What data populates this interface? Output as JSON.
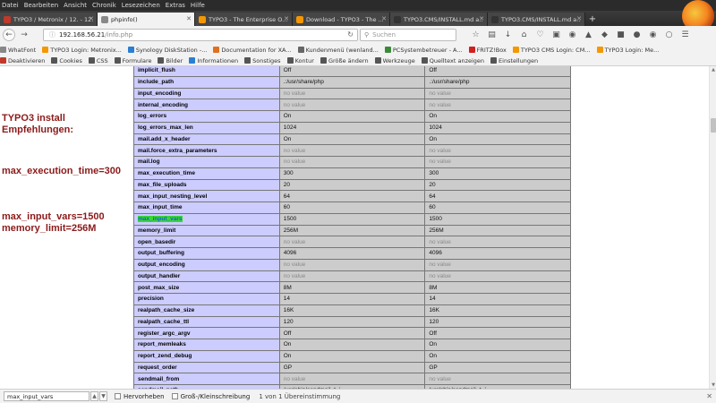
{
  "menu": [
    "Datei",
    "Bearbeiten",
    "Ansicht",
    "Chronik",
    "Lesezeichen",
    "Extras",
    "Hilfe"
  ],
  "tabs": [
    {
      "title": "TYPO3 / Metronix / 12. - 12.",
      "icon_color": "#c0392b",
      "active": false
    },
    {
      "title": "phpinfo()",
      "icon_color": "#888888",
      "active": true
    },
    {
      "title": "TYPO3 - The Enterprise O...",
      "icon_color": "#f49700",
      "active": false
    },
    {
      "title": "Download - TYPO3 - The ...",
      "icon_color": "#f49700",
      "active": false
    },
    {
      "title": "TYPO3.CMS/INSTALL.md a...",
      "icon_color": "#333333",
      "active": false
    },
    {
      "title": "TYPO3.CMS/INSTALL.md a...",
      "icon_color": "#333333",
      "active": false
    }
  ],
  "newtab_label": "+",
  "url": {
    "host": "192.168.56.21",
    "path": "/info.php"
  },
  "search_placeholder": "Suchen",
  "bookmarks_row1": [
    {
      "label": "WhatFont",
      "color": "#888"
    },
    {
      "label": "TYPO3 Login: Metronix...",
      "color": "#f49700"
    },
    {
      "label": "Synology DiskStation -...",
      "color": "#2a7fd4"
    },
    {
      "label": "Documentation for XA...",
      "color": "#e07020"
    },
    {
      "label": "Kundenmenü (wenland...",
      "color": "#666"
    },
    {
      "label": "PCSystembetreuer - A...",
      "color": "#3a8a3a"
    },
    {
      "label": "FRITZ!Box",
      "color": "#d02020"
    },
    {
      "label": "TYPO3 CMS Login: CM...",
      "color": "#f49700"
    },
    {
      "label": "TYPO3 Login: Me...",
      "color": "#f49700"
    }
  ],
  "bookmarks_row2": [
    {
      "label": "Deaktivieren",
      "color": "#c0392b"
    },
    {
      "label": "Cookies",
      "color": "#555"
    },
    {
      "label": "CSS",
      "color": "#555"
    },
    {
      "label": "Formulare",
      "color": "#555"
    },
    {
      "label": "Bilder",
      "color": "#555"
    },
    {
      "label": "Informationen",
      "color": "#2a7fd4"
    },
    {
      "label": "Sonstiges",
      "color": "#555"
    },
    {
      "label": "Kontur",
      "color": "#555"
    },
    {
      "label": "Größe ändern",
      "color": "#555"
    },
    {
      "label": "Werkzeuge",
      "color": "#555"
    },
    {
      "label": "Quelltext anzeigen",
      "color": "#555"
    },
    {
      "label": "Einstellungen",
      "color": "#555"
    }
  ],
  "notes": {
    "heading": "TYPO3 install\nEmpfehlungen:",
    "exec_time": "max_execution_time=300",
    "input_vars_memory": "max_input_vars=1500\nmemory_limit=256M"
  },
  "rows": [
    {
      "key": "implicit_flush",
      "local": "Off",
      "master": "Off",
      "nv": false
    },
    {
      "key": "include_path",
      "local": ".:/usr/share/php",
      "master": ".:/usr/share/php",
      "nv": false
    },
    {
      "key": "input_encoding",
      "local": "no value",
      "master": "no value",
      "nv": true
    },
    {
      "key": "internal_encoding",
      "local": "no value",
      "master": "no value",
      "nv": true
    },
    {
      "key": "log_errors",
      "local": "On",
      "master": "On",
      "nv": false
    },
    {
      "key": "log_errors_max_len",
      "local": "1024",
      "master": "1024",
      "nv": false
    },
    {
      "key": "mail.add_x_header",
      "local": "On",
      "master": "On",
      "nv": false
    },
    {
      "key": "mail.force_extra_parameters",
      "local": "no value",
      "master": "no value",
      "nv": true
    },
    {
      "key": "mail.log",
      "local": "no value",
      "master": "no value",
      "nv": true
    },
    {
      "key": "max_execution_time",
      "local": "300",
      "master": "300",
      "nv": false
    },
    {
      "key": "max_file_uploads",
      "local": "20",
      "master": "20",
      "nv": false
    },
    {
      "key": "max_input_nesting_level",
      "local": "64",
      "master": "64",
      "nv": false
    },
    {
      "key": "max_input_time",
      "local": "60",
      "master": "60",
      "nv": false
    },
    {
      "key": "max_input_vars",
      "local": "1500",
      "master": "1500",
      "nv": false,
      "highlight": true
    },
    {
      "key": "memory_limit",
      "local": "256M",
      "master": "256M",
      "nv": false
    },
    {
      "key": "open_basedir",
      "local": "no value",
      "master": "no value",
      "nv": true
    },
    {
      "key": "output_buffering",
      "local": "4096",
      "master": "4096",
      "nv": false
    },
    {
      "key": "output_encoding",
      "local": "no value",
      "master": "no value",
      "nv": true
    },
    {
      "key": "output_handler",
      "local": "no value",
      "master": "no value",
      "nv": true
    },
    {
      "key": "post_max_size",
      "local": "8M",
      "master": "8M",
      "nv": false
    },
    {
      "key": "precision",
      "local": "14",
      "master": "14",
      "nv": false
    },
    {
      "key": "realpath_cache_size",
      "local": "16K",
      "master": "16K",
      "nv": false
    },
    {
      "key": "realpath_cache_ttl",
      "local": "120",
      "master": "120",
      "nv": false
    },
    {
      "key": "register_argc_argv",
      "local": "Off",
      "master": "Off",
      "nv": false
    },
    {
      "key": "report_memleaks",
      "local": "On",
      "master": "On",
      "nv": false
    },
    {
      "key": "report_zend_debug",
      "local": "On",
      "master": "On",
      "nv": false
    },
    {
      "key": "request_order",
      "local": "GP",
      "master": "GP",
      "nv": false
    },
    {
      "key": "sendmail_from",
      "local": "no value",
      "master": "no value",
      "nv": true
    },
    {
      "key": "sendmail_path",
      "local": "/usr/sbin/sendmail -t -i",
      "master": "/usr/sbin/sendmail -t -i",
      "nv": false
    }
  ],
  "findbar": {
    "query": "max_input_vars",
    "highlight_all": "Hervorheben",
    "match_case": "Groß-/Kleinschreibung",
    "match_count": "1 von 1 Übereinstimmung"
  },
  "colors": {
    "key_cell": "#ccccff",
    "value_cell": "#cccccc",
    "note_text": "#8b1a1a",
    "find_highlight": "#38d830"
  }
}
